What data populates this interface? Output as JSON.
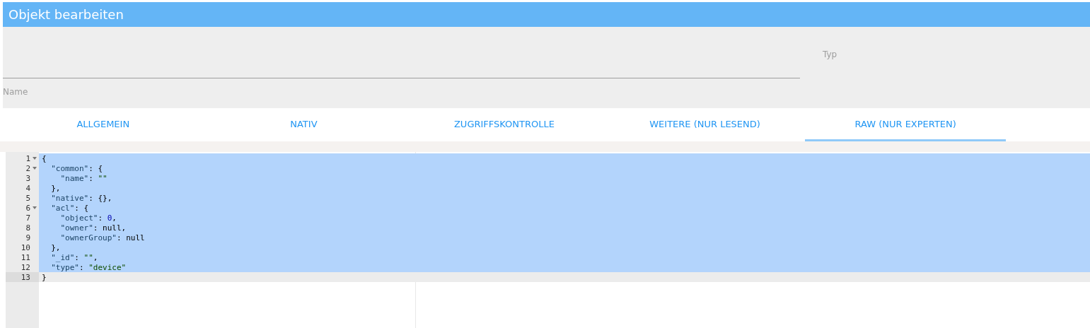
{
  "window": {
    "title": "Objekt bearbeiten"
  },
  "fields": {
    "name": {
      "label": "Name"
    },
    "type": {
      "label": "Typ"
    }
  },
  "tabs": [
    {
      "label": "ALLGEMEIN",
      "selected": false
    },
    {
      "label": "NATIV",
      "selected": false
    },
    {
      "label": "ZUGRIFFSKONTROLLE",
      "selected": false
    },
    {
      "label": "WEITERE (NUR LESEND)",
      "selected": false
    },
    {
      "label": "RAW (NUR EXPERTEN)",
      "selected": true
    }
  ],
  "editor": {
    "lines": [
      {
        "number": "1",
        "foldable": true,
        "selected": true,
        "active": false,
        "tokens": [
          {
            "kind": "punct",
            "text": "{"
          }
        ]
      },
      {
        "number": "2",
        "foldable": true,
        "selected": true,
        "active": false,
        "tokens": [
          {
            "kind": "key",
            "text": "  \"common\""
          },
          {
            "kind": "punct",
            "text": ": {"
          }
        ]
      },
      {
        "number": "3",
        "foldable": false,
        "selected": true,
        "active": false,
        "tokens": [
          {
            "kind": "key",
            "text": "    \"name\""
          },
          {
            "kind": "punct",
            "text": ": "
          },
          {
            "kind": "string",
            "text": "\"\""
          }
        ]
      },
      {
        "number": "4",
        "foldable": false,
        "selected": true,
        "active": false,
        "tokens": [
          {
            "kind": "punct",
            "text": "  },"
          }
        ]
      },
      {
        "number": "5",
        "foldable": false,
        "selected": true,
        "active": false,
        "tokens": [
          {
            "kind": "key",
            "text": "  \"native\""
          },
          {
            "kind": "punct",
            "text": ": {},"
          }
        ]
      },
      {
        "number": "6",
        "foldable": true,
        "selected": true,
        "active": false,
        "tokens": [
          {
            "kind": "key",
            "text": "  \"acl\""
          },
          {
            "kind": "punct",
            "text": ": {"
          }
        ]
      },
      {
        "number": "7",
        "foldable": false,
        "selected": true,
        "active": false,
        "tokens": [
          {
            "kind": "key",
            "text": "    \"object\""
          },
          {
            "kind": "punct",
            "text": ": "
          },
          {
            "kind": "number",
            "text": "0"
          },
          {
            "kind": "punct",
            "text": ","
          }
        ]
      },
      {
        "number": "8",
        "foldable": false,
        "selected": true,
        "active": false,
        "tokens": [
          {
            "kind": "key",
            "text": "    \"owner\""
          },
          {
            "kind": "punct",
            "text": ": "
          },
          {
            "kind": "constant",
            "text": "null"
          },
          {
            "kind": "punct",
            "text": ","
          }
        ]
      },
      {
        "number": "9",
        "foldable": false,
        "selected": true,
        "active": false,
        "tokens": [
          {
            "kind": "key",
            "text": "    \"ownerGroup\""
          },
          {
            "kind": "punct",
            "text": ": "
          },
          {
            "kind": "constant",
            "text": "null"
          }
        ]
      },
      {
        "number": "10",
        "foldable": false,
        "selected": true,
        "active": false,
        "tokens": [
          {
            "kind": "punct",
            "text": "  },"
          }
        ]
      },
      {
        "number": "11",
        "foldable": false,
        "selected": true,
        "active": false,
        "tokens": [
          {
            "kind": "key",
            "text": "  \"_id\""
          },
          {
            "kind": "punct",
            "text": ": "
          },
          {
            "kind": "string",
            "text": "\"\""
          },
          {
            "kind": "punct",
            "text": ","
          }
        ]
      },
      {
        "number": "12",
        "foldable": false,
        "selected": true,
        "active": false,
        "tokens": [
          {
            "kind": "key",
            "text": "  \"type\""
          },
          {
            "kind": "punct",
            "text": ": "
          },
          {
            "kind": "string",
            "text": "\"device\""
          }
        ]
      },
      {
        "number": "13",
        "foldable": false,
        "selected": false,
        "active": true,
        "tokens": [
          {
            "kind": "punct",
            "text": "}"
          }
        ]
      }
    ]
  }
}
